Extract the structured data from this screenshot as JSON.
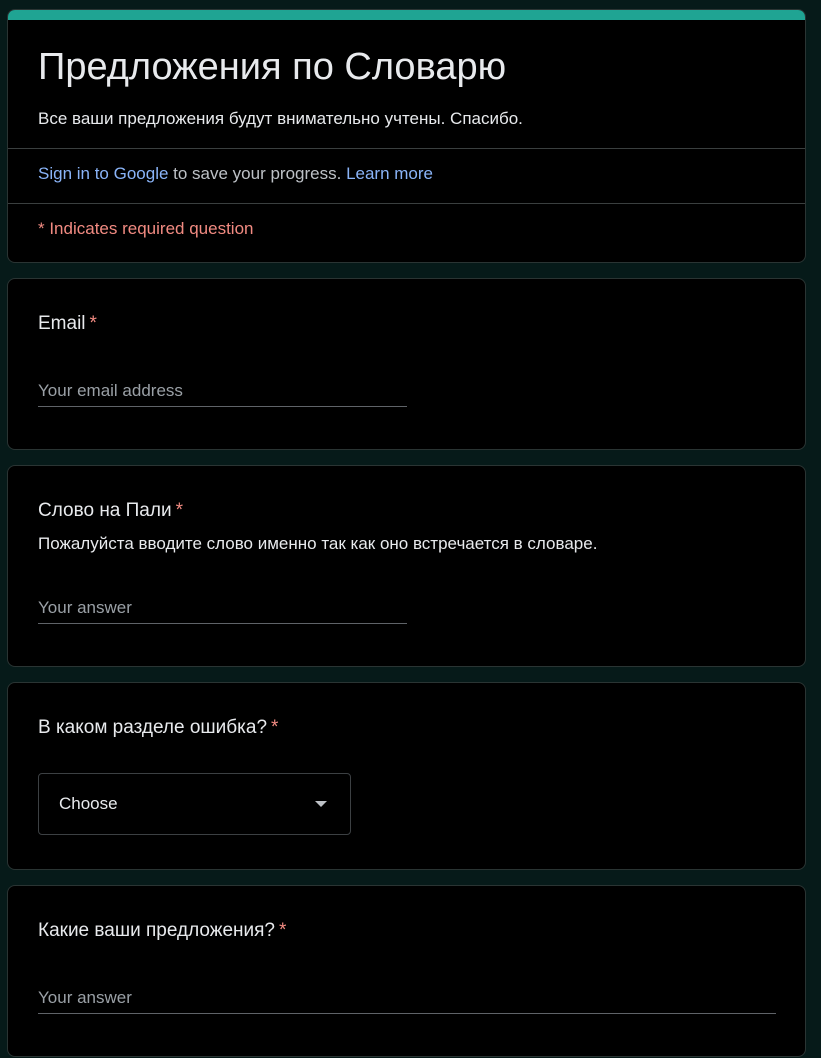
{
  "header": {
    "title": "Предложения по Словарю",
    "description": "Все ваши предложения будут внимательно учтены. Спасибо.",
    "signin_link": "Sign in to Google",
    "signin_text": " to save your progress. ",
    "learn_more": "Learn more",
    "required_note": "* Indicates required question",
    "accent_color": "#1fa493"
  },
  "questions": {
    "email": {
      "label": "Email",
      "required_mark": "*",
      "placeholder": "Your email address",
      "value": ""
    },
    "pali_word": {
      "label": "Слово на Пали",
      "required_mark": "*",
      "help": "Пожалуйста вводите слово именно так как оно встречается в словаре.",
      "placeholder": "Your answer",
      "value": ""
    },
    "section": {
      "label": "В каком разделе ошибка?",
      "required_mark": "*",
      "selected": "Choose"
    },
    "suggestions": {
      "label": "Какие ваши предложения?",
      "required_mark": "*",
      "placeholder": "Your answer",
      "value": ""
    }
  }
}
